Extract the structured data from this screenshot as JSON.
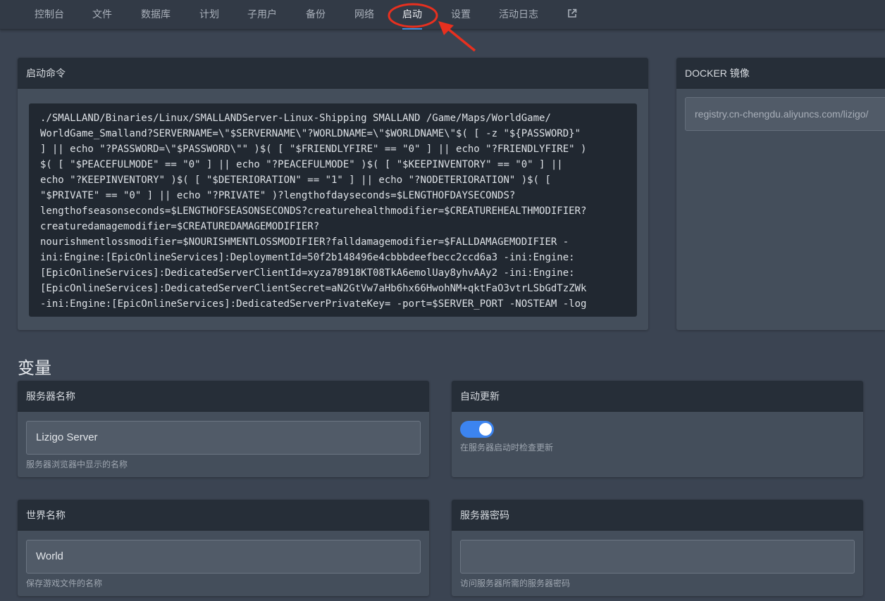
{
  "nav": {
    "items": [
      "控制台",
      "文件",
      "数据库",
      "计划",
      "子用户",
      "备份",
      "网络",
      "启动",
      "设置",
      "活动日志"
    ],
    "active": "启动",
    "external_icon": "external-link-icon"
  },
  "startup": {
    "title": "启动命令",
    "command_lines": [
      "./SMALLAND/Binaries/Linux/SMALLANDServer-Linux-Shipping SMALLAND /Game/Maps/WorldGame/",
      "WorldGame_Smalland?SERVERNAME=\\\"$SERVERNAME\\\"?WORLDNAME=\\\"$WORLDNAME\\\"$( [ -z \"${PASSWORD}\"",
      "] || echo \"?PASSWORD=\\\"$PASSWORD\\\"\" )$( [ \"$FRIENDLYFIRE\" == \"0\" ] || echo \"?FRIENDLYFIRE\" )",
      "$( [ \"$PEACEFULMODE\" == \"0\" ] || echo \"?PEACEFULMODE\" )$( [ \"$KEEPINVENTORY\" == \"0\" ] ||",
      "echo \"?KEEPINVENTORY\" )$( [ \"$DETERIORATION\" == \"1\" ] || echo \"?NODETERIORATION\" )$( [",
      "\"$PRIVATE\" == \"0\" ] || echo \"?PRIVATE\" )?lengthofdayseconds=$LENGTHOFDAYSECONDS?",
      "lengthofseasonseconds=$LENGTHOFSEASONSECONDS?creaturehealthmodifier=$CREATUREHEALTHMODIFIER?",
      "creaturedamagemodifier=$CREATUREDAMAGEMODIFIER?",
      "nourishmentlossmodifier=$NOURISHMENTLOSSMODIFIER?falldamagemodifier=$FALLDAMAGEMODIFIER -",
      "ini:Engine:[EpicOnlineServices]:DeploymentId=50f2b148496e4cbbbdeefbecc2ccd6a3 -ini:Engine:",
      "[EpicOnlineServices]:DedicatedServerClientId=xyza78918KT08TkA6emolUay8yhvAAy2 -ini:Engine:",
      "[EpicOnlineServices]:DedicatedServerClientSecret=aN2GtVw7aHb6hx66HwohNM+qktFaO3vtrLSbGdTzZWk",
      "-ini:Engine:[EpicOnlineServices]:DedicatedServerPrivateKey= -port=$SERVER_PORT -NOSTEAM -log"
    ]
  },
  "docker": {
    "title": "DOCKER 镜像",
    "image": "registry.cn-chengdu.aliyuncs.com/lizigo/"
  },
  "variables": {
    "title": "变量",
    "server_name": {
      "label": "服务器名称",
      "value": "Lizigo Server",
      "hint": "服务器浏览器中显示的名称"
    },
    "auto_update": {
      "label": "自动更新",
      "enabled": true,
      "hint": "在服务器启动时检查更新"
    },
    "world_name": {
      "label": "世界名称",
      "value": "World",
      "hint": "保存游戏文件的名称"
    },
    "server_password": {
      "label": "服务器密码",
      "value": "",
      "hint": "访问服务器所需的服务器密码"
    }
  },
  "colors": {
    "accent": "#3c84f0",
    "annotation": "#e8301f"
  }
}
